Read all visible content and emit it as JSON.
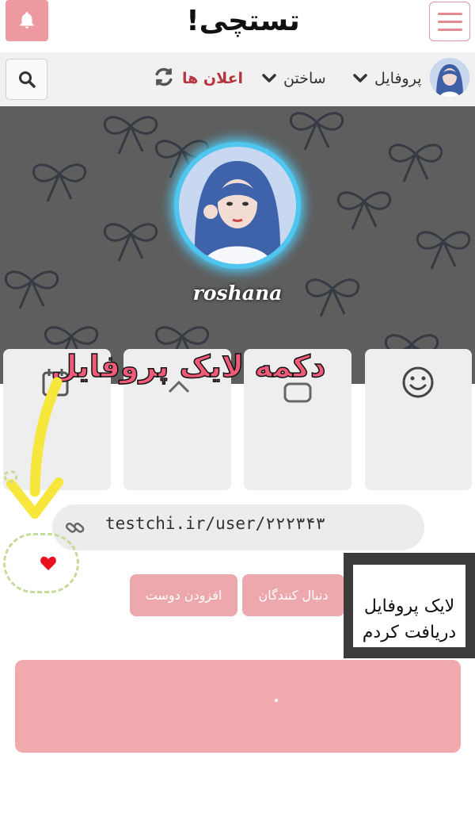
{
  "header": {
    "logo_text": "تستچی!",
    "bell_icon": "bell-icon",
    "menu_icon": "hamburger-icon"
  },
  "nav": {
    "profile_label": "پروفایل",
    "build_label": "ساختن",
    "notifications_label": "اعلان ها",
    "refresh_icon": "refresh-icon",
    "search_icon": "search-icon",
    "notifications_color": "#b3363f"
  },
  "profile": {
    "username": "roshana",
    "link": "testchi.ir/user/۲۲۲۳۴۳",
    "ring_color": "#4fc6ef"
  },
  "annotation": {
    "title": "دکمه لایک پروفایل",
    "received_line1": "لایک پروفایل",
    "received_line2": "دریافت کردم"
  },
  "buttons": {
    "followers_label": "دنبال کنندگان",
    "add_friend_label": "افزودن دوست"
  },
  "colors": {
    "accent_pink": "#eca8ad",
    "heart_red": "#e8121f",
    "arrow_yellow": "#f5e63a"
  }
}
